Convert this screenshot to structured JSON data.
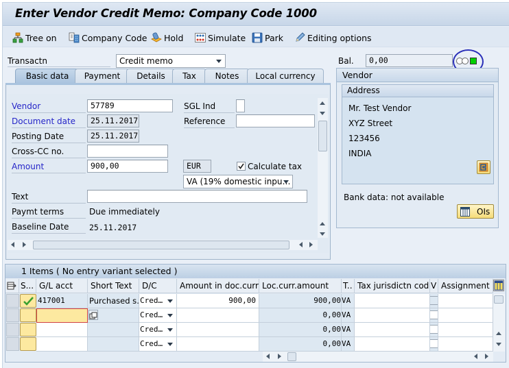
{
  "title": "Enter Vendor Credit Memo: Company Code 1000",
  "toolbar": {
    "items": [
      {
        "label": "Tree on",
        "icon": "tree-icon"
      },
      {
        "label": "Company Code",
        "icon": "company-code-icon"
      },
      {
        "label": "Hold",
        "icon": "hold-icon"
      },
      {
        "label": "Simulate",
        "icon": "simulate-icon"
      },
      {
        "label": "Park",
        "icon": "save-icon"
      },
      {
        "label": "Editing options",
        "icon": "pencil-icon"
      }
    ]
  },
  "header": {
    "transaction_label": "Transactn",
    "transaction_value": "Credit memo",
    "balance_label": "Bal.",
    "balance_value": "0,00",
    "traffic_light": {
      "red": "off",
      "yellow": "off",
      "green": "on",
      "color": "#00d000"
    }
  },
  "tabs": [
    {
      "label": "Basic data",
      "active": true
    },
    {
      "label": "Payment",
      "active": false
    },
    {
      "label": "Details",
      "active": false
    },
    {
      "label": "Tax",
      "active": false
    },
    {
      "label": "Notes",
      "active": false
    },
    {
      "label": "Local currency",
      "active": false
    }
  ],
  "basic": {
    "vendor_label": "Vendor",
    "vendor_value": "57789",
    "sgl_label": "SGL Ind",
    "sgl_value": "",
    "docdate_label": "Document date",
    "docdate_value": "25.11.2017",
    "reference_label": "Reference",
    "reference_value": "",
    "postdate_label": "Posting Date",
    "postdate_value": "25.11.2017",
    "crosscc_label": "Cross-CC no.",
    "crosscc_value": "",
    "amount_label": "Amount",
    "amount_value": "900,00",
    "currency": "EUR",
    "calc_tax_label": "Calculate tax",
    "calc_tax_checked": true,
    "tax_code": "VA (19% domestic inpu…",
    "text_label": "Text",
    "text_value": "",
    "payterms_label": "Paymt terms",
    "payterms_value": "Due immediately",
    "baseline_label": "Baseline Date",
    "baseline_value": "25.11.2017"
  },
  "vendor_panel": {
    "title": "Vendor",
    "address_title": "Address",
    "address_lines": [
      "Mr. Test Vendor",
      "XYZ Street",
      "123456",
      "INDIA"
    ],
    "bank_text": "Bank data: not available",
    "ois_label": "OIs"
  },
  "items": {
    "title": "1 Items ( No entry variant selected )",
    "columns": [
      "S...",
      "G/L acct",
      "Short Text",
      "D/C",
      "Amount in doc.curr.",
      "Loc.curr.amount",
      "T..",
      "Tax jurisdictn code",
      "V",
      "Assignment n"
    ],
    "rows": [
      {
        "status": "ok",
        "gl": "417001",
        "short_text": "Purchased s…",
        "dc": "Cred…",
        "amount_doc": "900,00",
        "amount_loc": "900,00",
        "tax": "VA",
        "jur": "",
        "assignment": ""
      },
      {
        "status": "",
        "gl": "",
        "short_text": "",
        "dc": "Cred…",
        "amount_doc": "",
        "amount_loc": "0,00",
        "tax": "VA",
        "jur": "",
        "assignment": ""
      },
      {
        "status": "",
        "gl": "",
        "short_text": "",
        "dc": "Cred…",
        "amount_doc": "",
        "amount_loc": "0,00",
        "tax": "VA",
        "jur": "",
        "assignment": ""
      },
      {
        "status": "",
        "gl": "",
        "short_text": "",
        "dc": "Cred…",
        "amount_doc": "",
        "amount_loc": "0,00",
        "tax": "VA",
        "jur": "",
        "assignment": ""
      }
    ]
  },
  "colors": {
    "accent_blue_label": "#2525c8",
    "annotation_circle": "#2a2fb8"
  }
}
